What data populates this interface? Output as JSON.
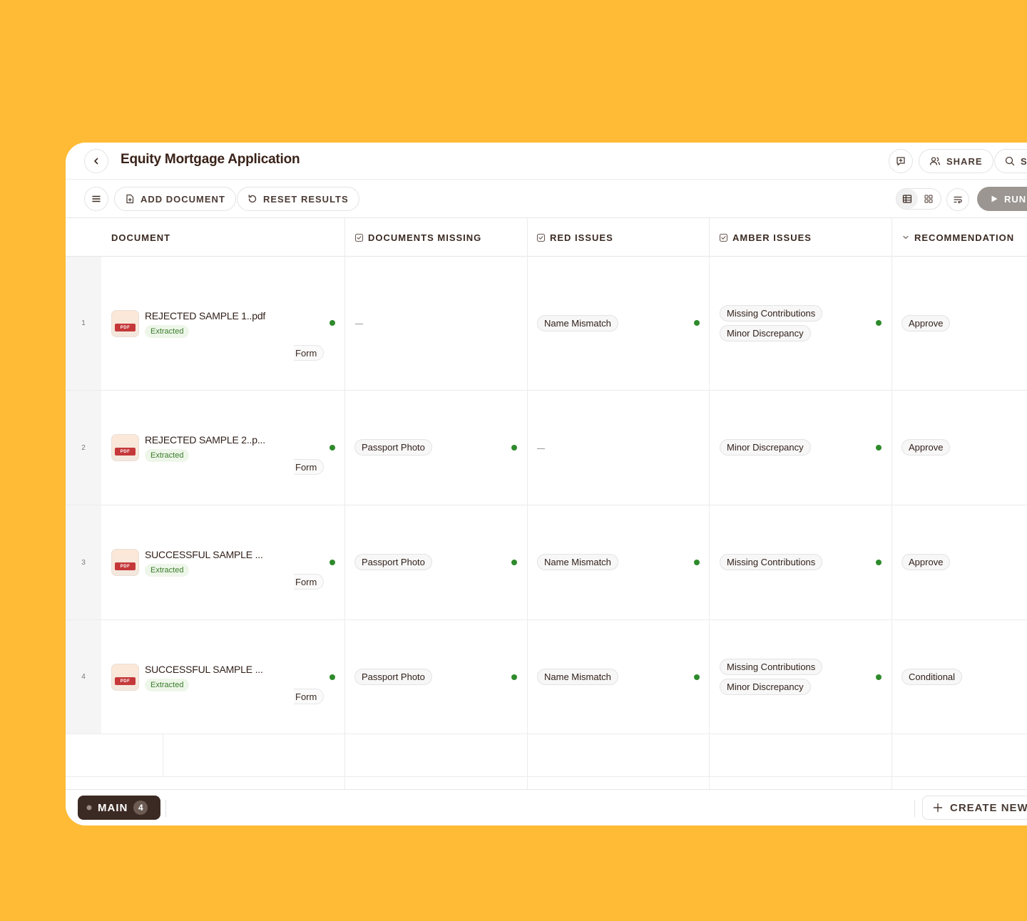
{
  "header": {
    "title": "Equity Mortgage Application",
    "share_label": "SHARE",
    "search_label": "S"
  },
  "toolbar": {
    "add_document_label": "ADD DOCUMENT",
    "reset_results_label": "RESET RESULTS",
    "run_label": "RUN"
  },
  "columns": {
    "document": "DOCUMENT",
    "documents_missing": "DOCUMENTS MISSING",
    "red_issues": "RED ISSUES",
    "amber_issues": "AMBER ISSUES",
    "recommendation": "RECOMMENDATION"
  },
  "rows": [
    {
      "num": "1",
      "file_name": "REJECTED SAMPLE 1..pdf",
      "file_type": "PDF",
      "status": "Extracted",
      "tag": "Form",
      "documents_missing": "—",
      "red_issues": [
        "Name Mismatch"
      ],
      "amber_issues": [
        "Missing Contributions",
        "Minor Discrepancy"
      ],
      "recommendation": "Approve"
    },
    {
      "num": "2",
      "file_name": "REJECTED SAMPLE 2..p...",
      "file_type": "PDF",
      "status": "Extracted",
      "tag": "Form",
      "documents_missing": "Passport Photo",
      "red_issues": [
        "—"
      ],
      "amber_issues": [
        "Minor Discrepancy"
      ],
      "recommendation": "Approve"
    },
    {
      "num": "3",
      "file_name": "SUCCESSFUL SAMPLE ...",
      "file_type": "PDF",
      "status": "Extracted",
      "tag": "Form",
      "documents_missing": "Passport Photo",
      "red_issues": [
        "Name Mismatch"
      ],
      "amber_issues": [
        "Missing Contributions"
      ],
      "recommendation": "Approve"
    },
    {
      "num": "4",
      "file_name": "SUCCESSFUL SAMPLE ...",
      "file_type": "PDF",
      "status": "Extracted",
      "tag": "Form",
      "documents_missing": "Passport Photo",
      "red_issues": [
        "Name Mismatch"
      ],
      "amber_issues": [
        "Missing Contributions",
        "Minor Discrepancy"
      ],
      "recommendation": "Conditional"
    }
  ],
  "footer": {
    "tab_label": "MAIN",
    "tab_count": "4",
    "create_new_label": "CREATE NEW"
  },
  "colors": {
    "background": "#FFBB36",
    "status_dot": "#2e8a2b",
    "pdf_badge": "#c5383a",
    "tab_dark": "#3b2a23"
  }
}
